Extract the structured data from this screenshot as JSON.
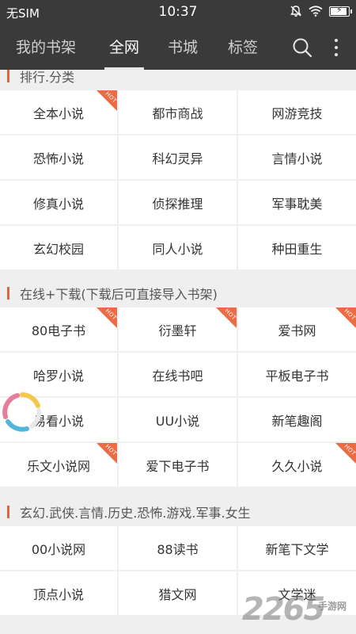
{
  "status_bar": {
    "carrier": "无SIM",
    "time": "10:37"
  },
  "tabs": [
    {
      "label": "我的书架",
      "active": false
    },
    {
      "label": "全网",
      "active": true
    },
    {
      "label": "书城",
      "active": false
    },
    {
      "label": "标签",
      "active": false
    }
  ],
  "hot_badge": "HOT",
  "sections": [
    {
      "title": "排行.分类",
      "items": [
        {
          "label": "全本小说",
          "hot": true
        },
        {
          "label": "都市商战",
          "hot": false
        },
        {
          "label": "网游竞技",
          "hot": false
        },
        {
          "label": "恐怖小说",
          "hot": false
        },
        {
          "label": "科幻灵异",
          "hot": false
        },
        {
          "label": "言情小说",
          "hot": false
        },
        {
          "label": "修真小说",
          "hot": false
        },
        {
          "label": "侦探推理",
          "hot": false
        },
        {
          "label": "军事耽美",
          "hot": false
        },
        {
          "label": "玄幻校园",
          "hot": false
        },
        {
          "label": "同人小说",
          "hot": false
        },
        {
          "label": "种田重生",
          "hot": false
        }
      ]
    },
    {
      "title": "在线+下载(下载后可直接导入书架)",
      "items": [
        {
          "label": "80电子书",
          "hot": true
        },
        {
          "label": "衍墨轩",
          "hot": true
        },
        {
          "label": "爱书网",
          "hot": true
        },
        {
          "label": "哈罗小说",
          "hot": false
        },
        {
          "label": "在线书吧",
          "hot": false
        },
        {
          "label": "平板电子书",
          "hot": false
        },
        {
          "label": "易看小说",
          "hot": false
        },
        {
          "label": "UU小说",
          "hot": false
        },
        {
          "label": "新笔趣阁",
          "hot": false
        },
        {
          "label": "乐文小说网",
          "hot": true
        },
        {
          "label": "爱下电子书",
          "hot": false
        },
        {
          "label": "久久小说",
          "hot": true
        }
      ]
    },
    {
      "title": "玄幻.武侠.言情.历史.恐怖.游戏.军事.女生",
      "items": [
        {
          "label": "00小说网",
          "hot": false
        },
        {
          "label": "88读书",
          "hot": false
        },
        {
          "label": "新笔下文学",
          "hot": false
        },
        {
          "label": "顶点小说",
          "hot": false
        },
        {
          "label": "猎文网",
          "hot": false
        },
        {
          "label": "文学迷",
          "hot": false
        }
      ]
    }
  ],
  "watermark": {
    "number": "2265",
    "site": "手游网"
  },
  "colors": {
    "accent": "#e0643c",
    "toolbar": "#3a3a3a",
    "hot_badge": "#ea6b44"
  }
}
